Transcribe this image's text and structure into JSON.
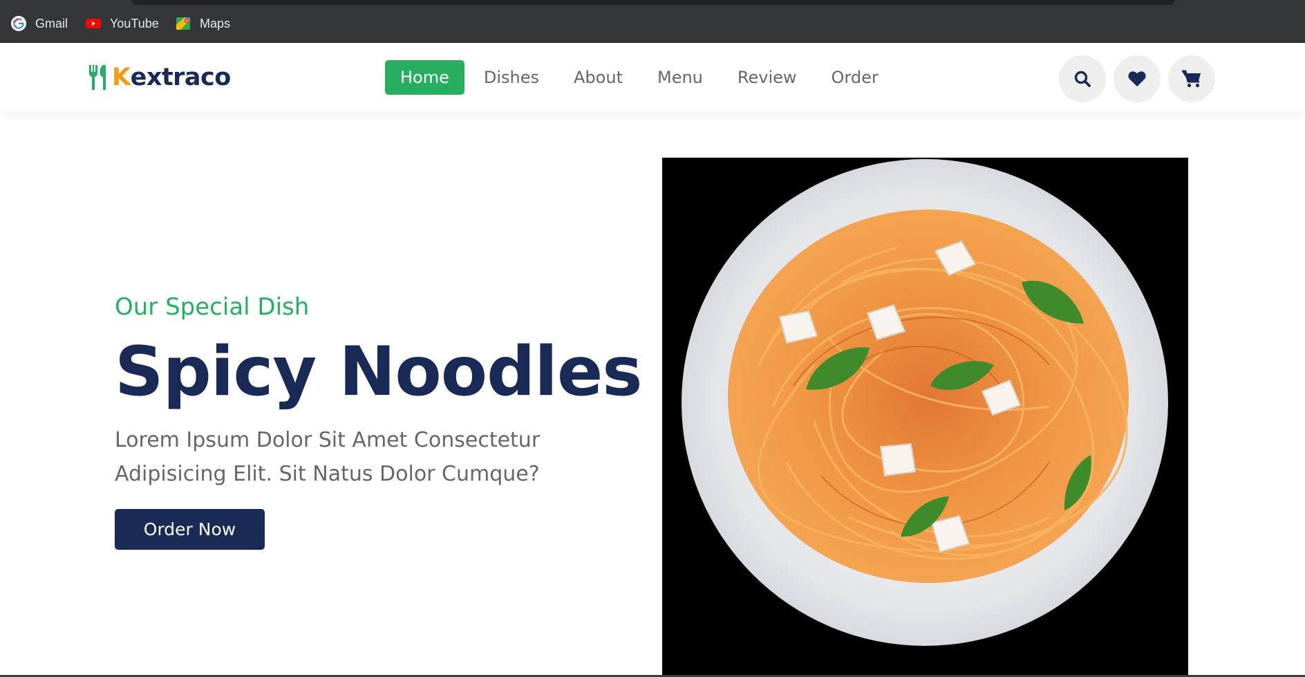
{
  "browser": {
    "bookmarks": [
      {
        "label": "Gmail",
        "icon": "google-icon"
      },
      {
        "label": "YouTube",
        "icon": "youtube-icon"
      },
      {
        "label": "Maps",
        "icon": "maps-icon"
      }
    ]
  },
  "header": {
    "logo": {
      "first_letter": "K",
      "rest": "extraco",
      "icon": "fork-spoon-icon"
    },
    "nav": [
      {
        "label": "Home",
        "active": true
      },
      {
        "label": "Dishes",
        "active": false
      },
      {
        "label": "About",
        "active": false
      },
      {
        "label": "Menu",
        "active": false
      },
      {
        "label": "Review",
        "active": false
      },
      {
        "label": "Order",
        "active": false
      }
    ],
    "actions": [
      {
        "icon": "search-icon"
      },
      {
        "icon": "heart-icon"
      },
      {
        "icon": "cart-icon"
      }
    ]
  },
  "hero": {
    "subtitle": "Our Special Dish",
    "title": "Spicy Noodles",
    "description": "Lorem Ipsum Dolor Sit Amet Consectetur Adipisicing Elit. Sit Natus Dolor Cumque?",
    "button_label": "Order Now",
    "image": "spaghetti-plate-image"
  },
  "colors": {
    "brand_green": "#27ae60",
    "brand_navy": "#192a56",
    "logo_orange": "#f39c12",
    "text_gray": "#666666",
    "icon_bg": "#eeeeee"
  }
}
